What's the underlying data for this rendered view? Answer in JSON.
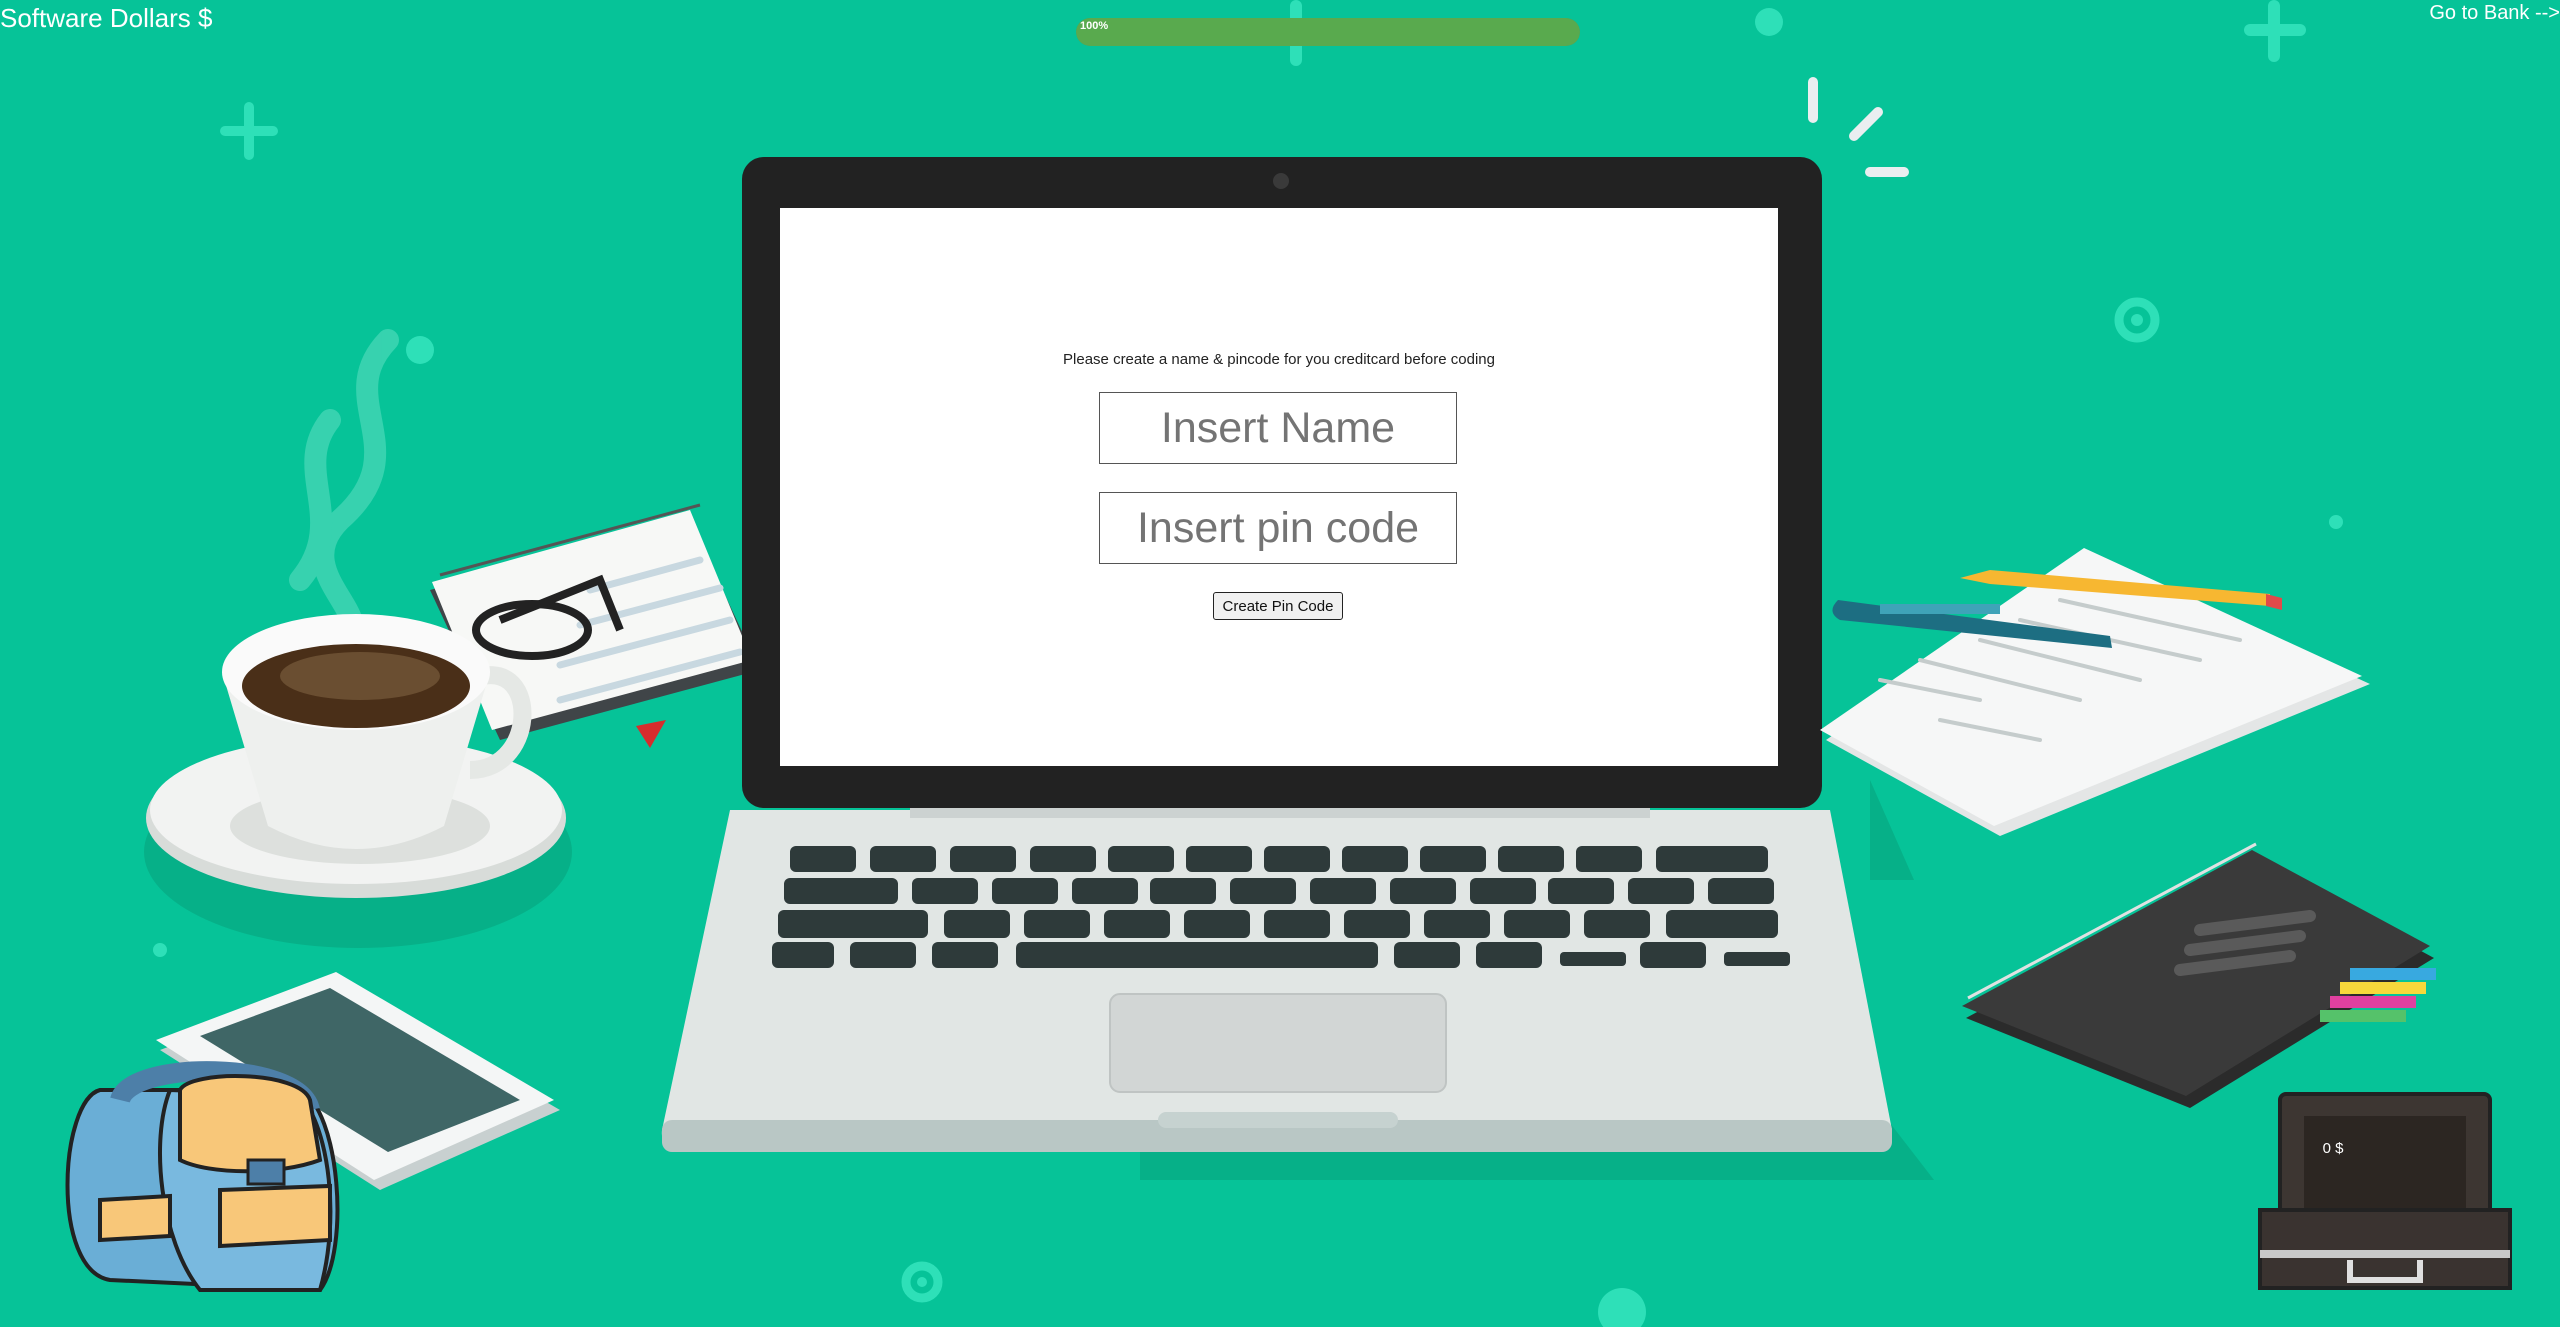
{
  "header": {
    "title": "Software Dollars $",
    "bank_link": "Go to Bank -->"
  },
  "progress": {
    "value_percent": 100,
    "label": "100%"
  },
  "form": {
    "prompt": "Please create a name & pincode for you creditcard before coding",
    "name_placeholder": "Insert Name",
    "pin_placeholder": "Insert pin code",
    "create_button": "Create Pin Code"
  },
  "wallet": {
    "amount": "0 $"
  },
  "colors": {
    "background": "#06c398",
    "progress": "#59aa4e",
    "laptop_frame": "#222222",
    "laptop_body": "#dfe4e2"
  }
}
